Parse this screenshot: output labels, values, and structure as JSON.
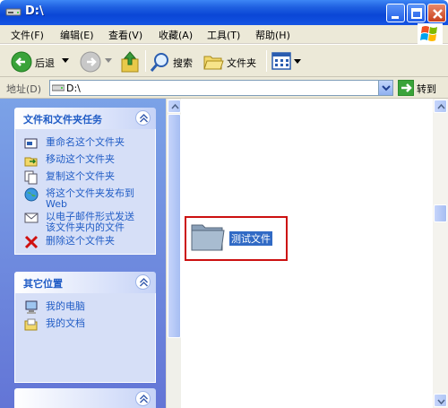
{
  "window": {
    "title": "D:\\"
  },
  "menu": [
    "文件(F)",
    "编辑(E)",
    "查看(V)",
    "收藏(A)",
    "工具(T)",
    "帮助(H)"
  ],
  "toolbar": {
    "back_label": "后退",
    "search_label": "搜索",
    "folders_label": "文件夹"
  },
  "address": {
    "label": "地址(D)",
    "value": "D:\\",
    "go_label": "转到"
  },
  "left_panel": {
    "tasks_title": "文件和文件夹任务",
    "tasks": [
      {
        "label": "重命名这个文件夹",
        "icon": "rename-icon"
      },
      {
        "label": "移动这个文件夹",
        "icon": "move-icon"
      },
      {
        "label": "复制这个文件夹",
        "icon": "copy-icon"
      },
      {
        "label": "将这个文件夹发布到",
        "label2": "Web",
        "icon": "publish-web-icon"
      },
      {
        "label": "以电子邮件形式发送",
        "label2": "该文件夹内的文件",
        "icon": "email-icon"
      },
      {
        "label": "删除这个文件夹",
        "icon": "delete-icon"
      }
    ],
    "places_title": "其它位置",
    "places": [
      {
        "label": "我的电脑",
        "icon": "my-computer-icon"
      },
      {
        "label": "我的文档",
        "icon": "my-documents-icon"
      }
    ]
  },
  "content": {
    "folder_name": "测试文件"
  },
  "colors": {
    "titlebar": "#0a46d6",
    "task_link": "#215dc6",
    "selection": "#316ac5",
    "highlight_border": "#cc1010"
  }
}
